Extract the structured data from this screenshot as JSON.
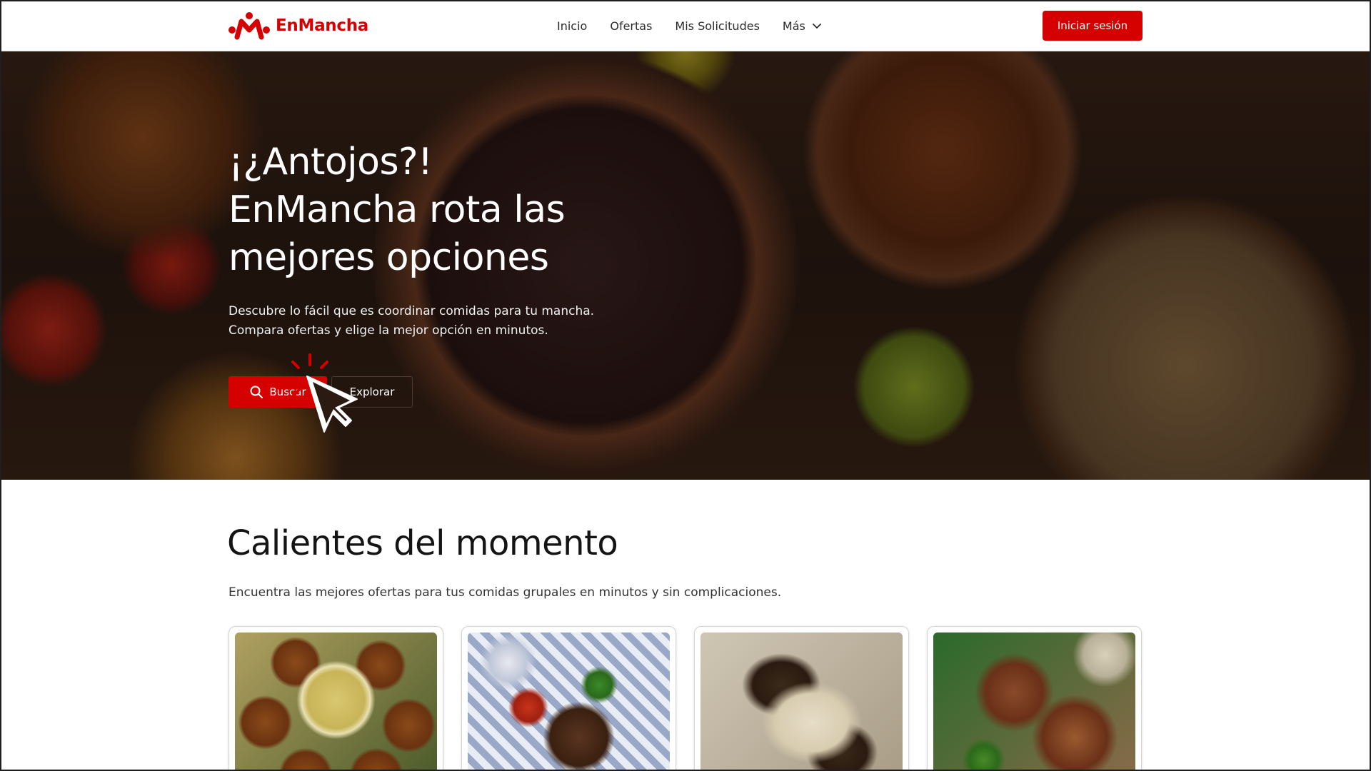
{
  "brand": {
    "name": "EnMancha",
    "accent": "#d50000"
  },
  "nav": {
    "links": [
      "Inicio",
      "Ofertas",
      "Mis Solicitudes",
      "Más"
    ],
    "login_label": "Iniciar sesión"
  },
  "hero": {
    "title_line1": "¡¿Antojos?!",
    "title_line2": "EnMancha rota las",
    "title_line3": "mejores opciones",
    "desc_line1": "Descubre lo fácil que es coordinar comidas para tu mancha.",
    "desc_line2": "Compara ofertas y elige la mejor opción en minutos.",
    "search_label": "Buscar",
    "explore_label": "Explorar"
  },
  "section": {
    "title": "Calientes del momento",
    "subtitle": "Encuentra las mejores ofertas para tus comidas grupales en minutos y sin complicaciones."
  },
  "icons": [
    "logo-icon",
    "chevron-down-icon",
    "search-icon",
    "click-cursor-icon"
  ]
}
